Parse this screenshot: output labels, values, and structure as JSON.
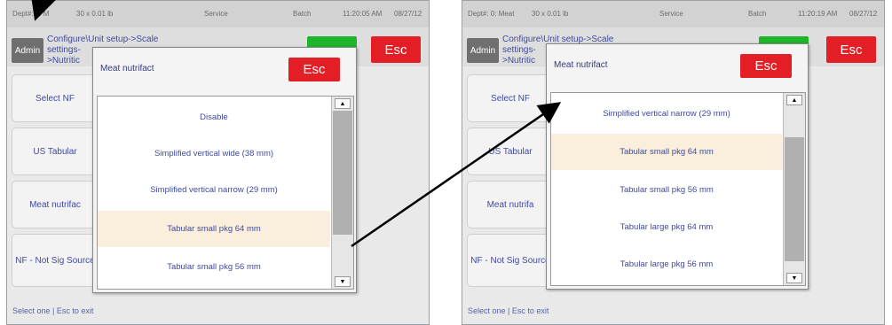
{
  "left": {
    "status": {
      "dept": "Dept#: 0: M",
      "weight": "30 x 0.01 lb",
      "service": "Service",
      "batch": "Batch",
      "time": "11:20:05 AM",
      "date": "08/27/12"
    },
    "admin_label": "Admin",
    "breadcrumb_line1": "Configure\\Unit setup->Scale settings-",
    "breadcrumb_line2": ">Nutritic",
    "green_label": "↓",
    "esc_label": "Esc",
    "side_buttons": [
      "Select NF",
      "US Tabular",
      "Meat nutrifac",
      "NF - Not Sig Source"
    ],
    "footer": "Select one | Esc to exit",
    "popup": {
      "title": "Meat nutrifact",
      "esc_label": "Esc",
      "items": [
        "Disable",
        "Simplified vertical wide (38 mm)",
        "Simplified vertical narrow (29 mm)",
        "Tabular small pkg 64 mm",
        "Tabular small pkg 56 mm"
      ],
      "selected_index": 3,
      "scroll_up": "▲",
      "scroll_down": "▼"
    }
  },
  "right": {
    "status": {
      "dept": "Dept#: 0: Meat",
      "weight": "30 x 0.01 lb",
      "service": "Service",
      "batch": "Batch",
      "time": "11:20:19 AM",
      "date": "08/27/12"
    },
    "admin_label": "Admin",
    "breadcrumb_line1": "Configure\\Unit setup->Scale settings-",
    "breadcrumb_line2": ">Nutritic",
    "green_label": "↓",
    "esc_label": "Esc",
    "side_buttons": [
      "Select NF",
      "US Tabular",
      "Meat nutrifa",
      "NF - Not Sig Source"
    ],
    "footer": "Select one | Esc to exit",
    "popup": {
      "title": "Meat nutrifact",
      "esc_label": "Esc",
      "items": [
        "Simplified vertical narrow (29 mm)",
        "Tabular small pkg 64 mm",
        "Tabular small pkg 56 mm",
        "Tabular large pkg 64 mm",
        "Tabular large pkg 56 mm"
      ],
      "selected_index": 1,
      "scroll_up": "▲",
      "scroll_down": "▼"
    }
  }
}
